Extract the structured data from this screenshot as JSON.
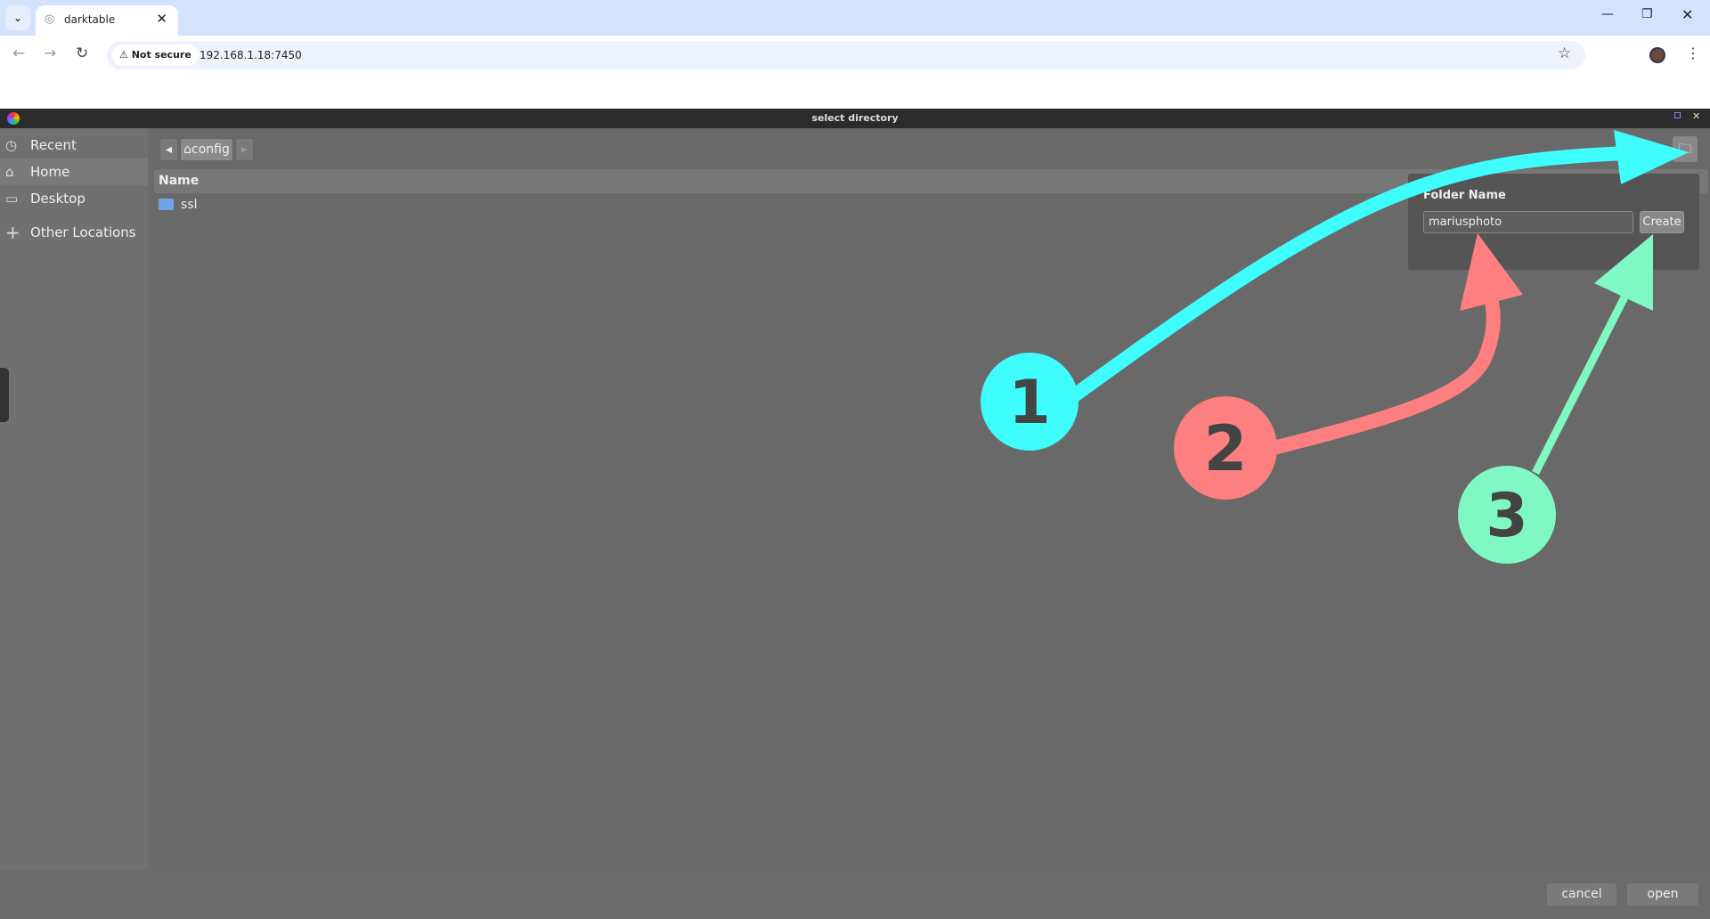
{
  "browser": {
    "tab_title": "darktable",
    "not_secure": "Not secure",
    "url": "192.168.1.18:7450"
  },
  "dialog": {
    "title": "select directory"
  },
  "sidebar": {
    "items": [
      {
        "label": "Recent",
        "icon": "clock-icon"
      },
      {
        "label": "Home",
        "icon": "home-icon"
      },
      {
        "label": "Desktop",
        "icon": "folder-icon"
      },
      {
        "label": "Other Locations",
        "icon": "plus-icon"
      }
    ]
  },
  "pathbar": {
    "current": "config"
  },
  "list": {
    "header": "Name",
    "rows": [
      {
        "name": "ssl"
      }
    ]
  },
  "popover": {
    "label": "Folder Name",
    "value": "mariusphoto",
    "create": "Create"
  },
  "footer": {
    "cancel": "cancel",
    "open": "open"
  },
  "annotations": {
    "steps": [
      "1",
      "2",
      "3"
    ],
    "colors": [
      "#3ffdfd",
      "#fe7f7f",
      "#7ff8c4"
    ]
  }
}
